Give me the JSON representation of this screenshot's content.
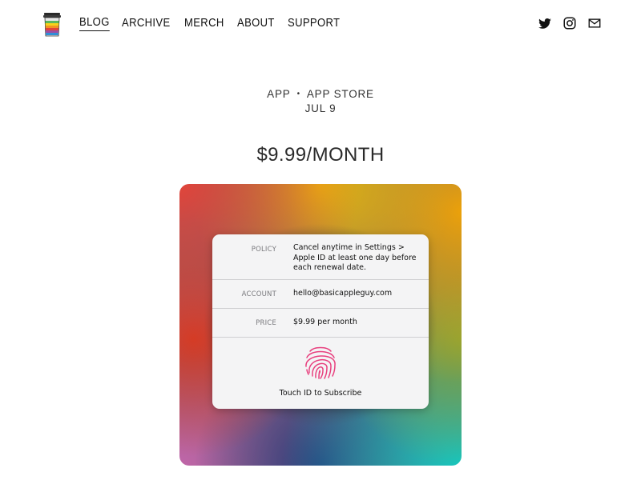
{
  "header": {
    "logo": "rainbow-cup-logo",
    "nav": [
      "BLOG",
      "ARCHIVE",
      "MERCH",
      "ABOUT",
      "SUPPORT"
    ],
    "active_nav": "BLOG",
    "social_icons": [
      "twitter-icon",
      "instagram-icon",
      "mail-icon"
    ]
  },
  "post": {
    "categories": [
      "APP",
      "APP STORE"
    ],
    "date": "JUL 9",
    "title": "$9.99/MONTH"
  },
  "purchase_sheet": {
    "policy_label": "POLICY",
    "policy_value": "Cancel anytime in Settings > Apple ID at least one day before each renewal date.",
    "account_label": "ACCOUNT",
    "account_value": "hello@basicappleguy.com",
    "price_label": "PRICE",
    "price_value": "$9.99 per month",
    "touch_label": "Touch ID to Subscribe"
  },
  "colors": {
    "fingerprint": "#e8417f",
    "card_background": "#f4f4f5"
  }
}
